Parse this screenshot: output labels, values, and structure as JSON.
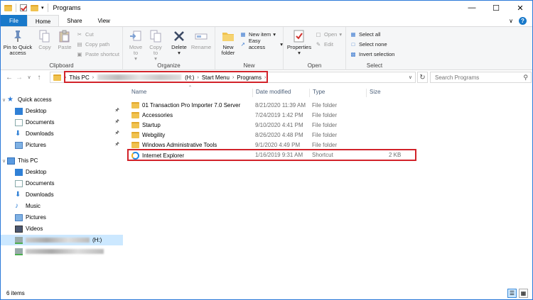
{
  "window": {
    "title": "Programs"
  },
  "tabs": {
    "file": "File",
    "home": "Home",
    "share": "Share",
    "view": "View"
  },
  "ribbon": {
    "clipboard": {
      "label": "Clipboard",
      "pin": "Pin to Quick access",
      "copy": "Copy",
      "paste": "Paste",
      "cut": "Cut",
      "copy_path": "Copy path",
      "paste_shortcut": "Paste shortcut"
    },
    "organize": {
      "label": "Organize",
      "move_to": "Move to",
      "copy_to": "Copy to",
      "delete": "Delete",
      "rename": "Rename"
    },
    "new": {
      "label": "New",
      "new_folder": "New folder",
      "new_item": "New item",
      "easy_access": "Easy access"
    },
    "open": {
      "label": "Open",
      "properties": "Properties",
      "open": "Open",
      "edit": "Edit"
    },
    "select": {
      "label": "Select",
      "select_all": "Select all",
      "select_none": "Select none",
      "invert": "Invert selection"
    }
  },
  "address": {
    "crumbs": [
      "This PC",
      "(H:)",
      "Start Menu",
      "Programs"
    ],
    "search_placeholder": "Search Programs"
  },
  "nav": {
    "quick_access": "Quick access",
    "quick_items": [
      "Desktop",
      "Documents",
      "Downloads",
      "Pictures"
    ],
    "this_pc": "This PC",
    "pc_items": [
      "Desktop",
      "Documents",
      "Downloads",
      "Music",
      "Pictures",
      "Videos"
    ],
    "drive_suffix": "(H:)"
  },
  "columns": {
    "name": "Name",
    "date": "Date modified",
    "type": "Type",
    "size": "Size"
  },
  "files": [
    {
      "name": "01 Transaction Pro Importer 7.0 Server",
      "date": "8/21/2020 11:39 AM",
      "type": "File folder",
      "size": ""
    },
    {
      "name": "Accessories",
      "date": "7/24/2019 1:42 PM",
      "type": "File folder",
      "size": ""
    },
    {
      "name": "Startup",
      "date": "9/10/2020 4:41 PM",
      "type": "File folder",
      "size": ""
    },
    {
      "name": "Webgility",
      "date": "8/26/2020 4:48 PM",
      "type": "File folder",
      "size": ""
    },
    {
      "name": "Windows Administrative Tools",
      "date": "9/1/2020 4:49 PM",
      "type": "File folder",
      "size": ""
    },
    {
      "name": "Internet Explorer",
      "date": "1/16/2019 9:31 AM",
      "type": "Shortcut",
      "size": "2 KB"
    }
  ],
  "status": {
    "count": "6 items"
  },
  "colors": {
    "accent": "#1979ca",
    "highlight": "#d2232a",
    "folder": "#f0c24f",
    "selection": "#cce8ff"
  }
}
